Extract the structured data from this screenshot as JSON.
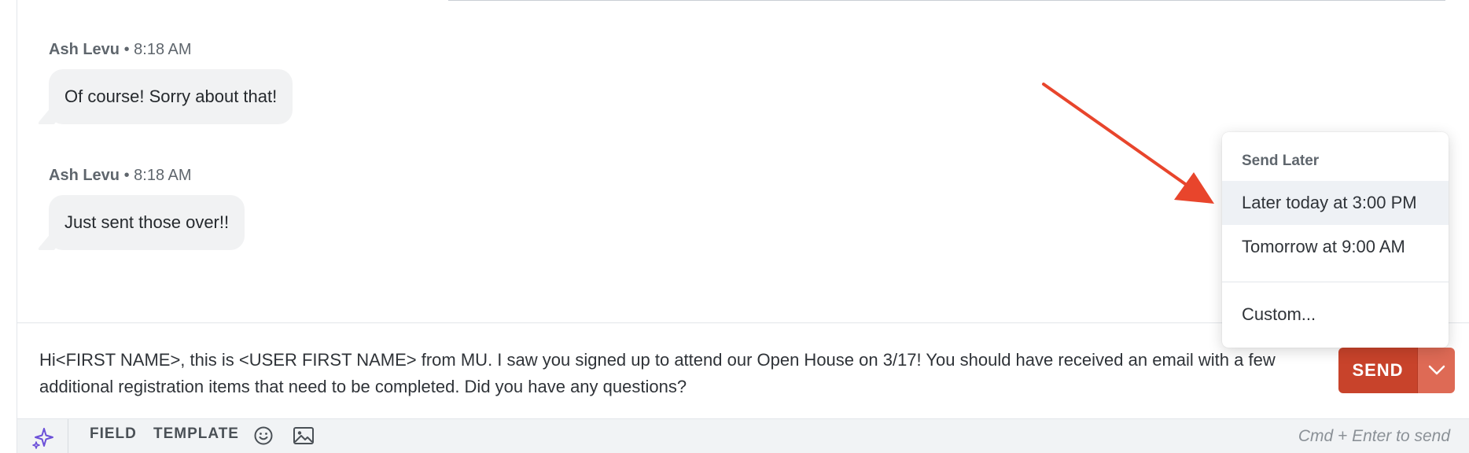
{
  "messages": [
    {
      "author": "Ash Levu",
      "separator": "•",
      "time": "8:18 AM",
      "text": "Of course! Sorry about that!"
    },
    {
      "author": "Ash Levu",
      "separator": "•",
      "time": "8:18 AM",
      "text": "Just sent those over!!"
    }
  ],
  "composer": {
    "text": "Hi<FIRST NAME>, this is <USER FIRST NAME> from MU. I saw you signed up to attend our Open House on 3/17! You should have received an email with a few additional registration items that need to be completed.  Did you have any questions?"
  },
  "send": {
    "label": "SEND",
    "caret_icon": "chevron-down-icon",
    "color": "#c8432b"
  },
  "send_later_menu": {
    "header": "Send Later",
    "items": [
      "Later today at 3:00 PM",
      "Tomorrow at 9:00 AM"
    ],
    "custom": "Custom..."
  },
  "toolbar": {
    "ai_icon": "sparkle-icon",
    "field_label": "FIELD",
    "template_label": "TEMPLATE",
    "emoji_icon": "smiley-icon",
    "image_icon": "image-icon",
    "hint": "Cmd + Enter to send"
  },
  "annotation": {
    "color": "#e8452c"
  }
}
